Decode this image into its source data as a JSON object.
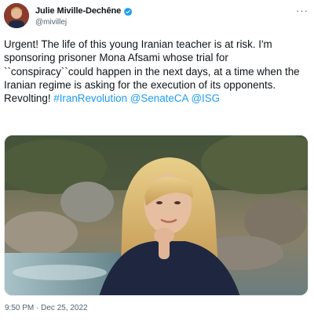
{
  "author": {
    "display_name": "Julie Miville-Dechêne",
    "handle": "@mivillej",
    "verified_icon": "verified-badge-icon",
    "avatar_icon": "avatar"
  },
  "menu_icon": "more-options-icon",
  "tweet": {
    "text_part_1": "Urgent! The life of this young Iranian teacher is at risk. I'm sponsoring prisoner Mona Afsami whose trial for ``conspiracy``could happen in the next days, at a time when the Iranian regime is asking for the execution of its opponents. Revolting! ",
    "hashtag": "#IranRevolution",
    "mention_1": "@SenateCA",
    "mention_2": "@ISG"
  },
  "media": {
    "type": "photo"
  },
  "timestamp": "9:50 PM · Dec 25, 2022",
  "colors": {
    "link": "#1d9bf0",
    "text": "#0f1419",
    "secondary": "#536471",
    "verified": "#1d9bf0"
  }
}
